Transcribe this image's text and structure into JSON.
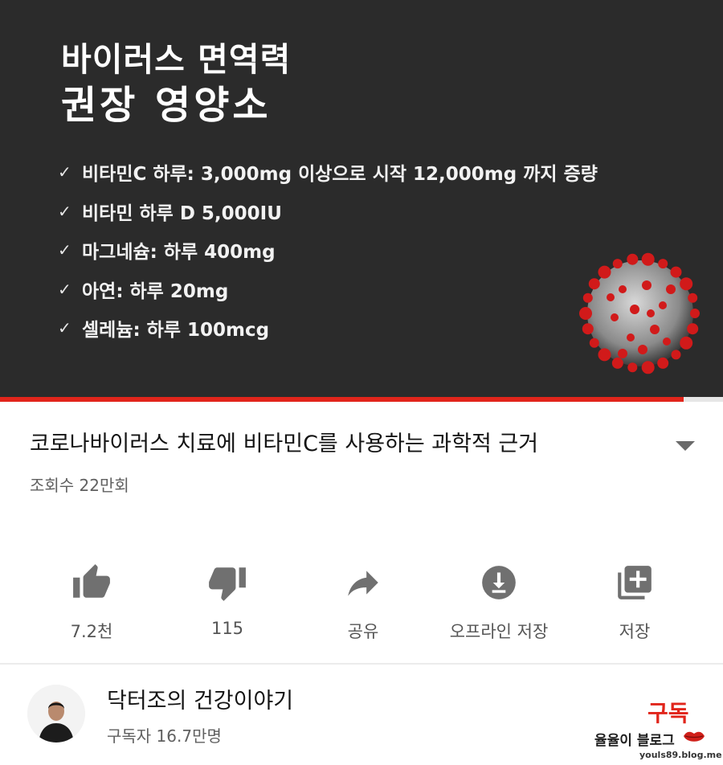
{
  "player": {
    "heading_line1": "바이러스 면역력",
    "heading_line2": "권장 영양소",
    "check_glyph": "✓",
    "nutrients": [
      "비타민C 하루:  3,000mg 이상으로 시작 12,000mg  까지 증량",
      "비타민 하루 D 5,000IU",
      "마그네슘: 하루 400mg",
      "아연: 하루 20mg",
      "셀레늄: 하루 100mcg"
    ],
    "progress": 0.945,
    "progress_color": "#e1251b"
  },
  "video": {
    "title": "코로나바이러스 치료에 비타민C를 사용하는 과학적 근거",
    "views": "조회수 22만회"
  },
  "actions": {
    "like": {
      "icon": "thumbs-up-icon",
      "label": "7.2천"
    },
    "dislike": {
      "icon": "thumbs-down-icon",
      "label": "115"
    },
    "share": {
      "icon": "share-arrow-icon",
      "label": "공유"
    },
    "offline": {
      "icon": "download-icon",
      "label": "오프라인 저장"
    },
    "save": {
      "icon": "playlist-add-icon",
      "label": "저장"
    }
  },
  "channel": {
    "name": "닥터조의 건강이야기",
    "subscribers": "구독자 16.7만명",
    "subscribe_label": "구독",
    "accent": "#e1251b"
  },
  "watermark": {
    "text": "율율이 블로그",
    "url": "youls89.blog.me"
  }
}
